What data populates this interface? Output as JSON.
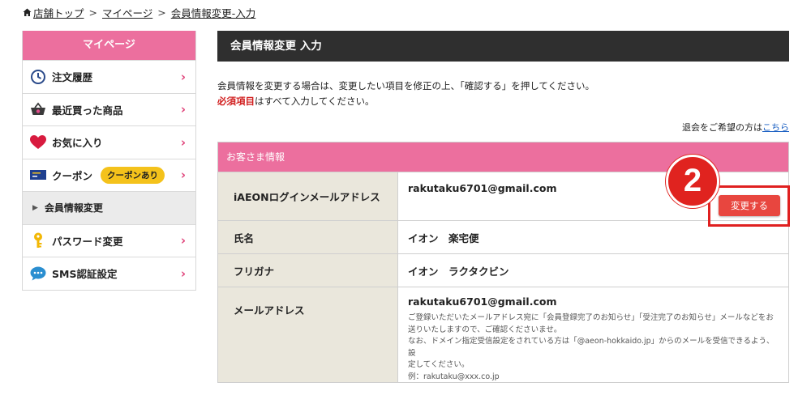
{
  "breadcrumb": {
    "home": "店舗トップ",
    "sep1": ">",
    "mypage": "マイページ",
    "sep2": ">",
    "current": "会員情報変更-入力"
  },
  "sidebar": {
    "title": "マイページ",
    "items": [
      {
        "label": "注文履歴",
        "icon": "clock-icon"
      },
      {
        "label": "最近買った商品",
        "icon": "basket-icon"
      },
      {
        "label": "お気に入り",
        "icon": "heart-icon"
      },
      {
        "label": "クーポン",
        "icon": "coupon-icon",
        "badge": "クーポンあり"
      },
      {
        "label": "会員情報変更",
        "active": true
      },
      {
        "label": "パスワード変更",
        "icon": "key-icon"
      },
      {
        "label": "SMS認証設定",
        "icon": "chat-icon"
      }
    ]
  },
  "main": {
    "title": "会員情報変更 入力",
    "intro_line1": "会員情報を変更する場合は、変更したい項目を修正の上、「確認する」を押してください。",
    "required_label": "必須項目",
    "intro_line2_rest": "はすべて入力してください。",
    "withdraw_text": "退会をご希望の方は",
    "withdraw_link": "こちら",
    "section_title": "お客さま情報",
    "rows": [
      {
        "label": "iAEONログインメールアドレス",
        "value": "rakutaku6701@gmail.com"
      },
      {
        "label": "氏名",
        "value": "イオン　楽宅便"
      },
      {
        "label": "フリガナ",
        "value": "イオン　ラクタクビン"
      },
      {
        "label": "メールアドレス",
        "value": "rakutaku6701@gmail.com"
      }
    ],
    "email_note": [
      "ご登録いただいたメールアドレス宛に「会員登録完了のお知らせ」「受注完了のお知らせ」メールなどをお",
      "送りいたしますので、ご確認くださいませ。",
      "なお、ドメイン指定受信設定をされている方は「@aeon-hokkaido.jp」からのメールを受信できるよう、設",
      "定してください。",
      "例：rakutaku@xxx.co.jp"
    ],
    "change_button": "変更する",
    "step_number": "2"
  },
  "colors": {
    "pink": "#ec6f9e",
    "dark_header": "#2f2f2f",
    "button_red": "#e8463f",
    "highlight_red": "#e02020",
    "badge_yellow": "#f4c21b"
  }
}
